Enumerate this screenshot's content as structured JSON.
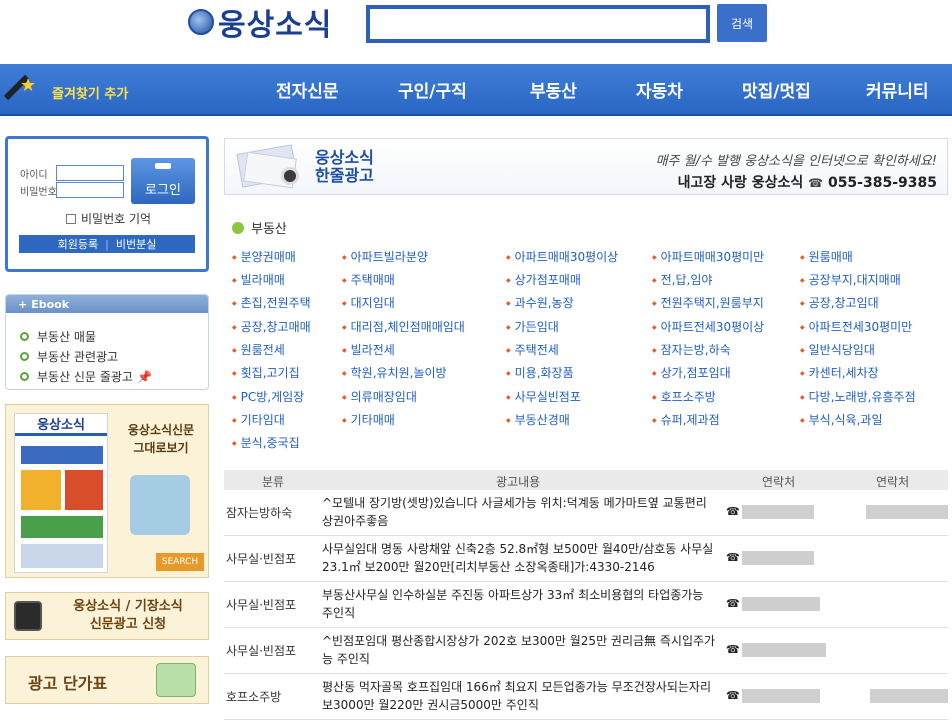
{
  "header": {
    "logo_text": "웅상소식",
    "search_value": "",
    "search_button": "검색"
  },
  "nav": {
    "favorite": "즐겨찾기 추가",
    "items": [
      "전자신문",
      "구인/구직",
      "부동산",
      "자동차",
      "맛집/멋집",
      "커뮤니티"
    ]
  },
  "login": {
    "id_label": "아이디",
    "pw_label": "비밀번호",
    "button": "로그인",
    "remember": "비밀번호 기억",
    "register": "회원등록",
    "find_pw": "비번분실"
  },
  "ebook": {
    "title": "Ebook",
    "items": [
      "부동산 매물",
      "부동산 관련광고",
      "부동산 신문 줄광고"
    ]
  },
  "banners": {
    "paper_title": "웅상소식",
    "paper_side": "웅상소식신문\n그대로보기",
    "search_tag": "SEARCH",
    "apply": "웅상소식 / 기장소식\n신문광고 신청",
    "price": "광고 단가표"
  },
  "hanjul": {
    "title": "웅상소식\n한줄광고",
    "notice": "매주 월/수 발행 웅상소식을 인터넷으로 확인하세요!",
    "contact_prefix": "내고장 사랑 웅상소식",
    "phone": "055-385-9385"
  },
  "section_title": "부동산",
  "categories": [
    [
      "분양권매매",
      "아파트빌라분양",
      "아파트매매30평이상",
      "아파트매매30평미만",
      "원룸매매"
    ],
    [
      "빌라매매",
      "주택매매",
      "상가점포매매",
      "전,답,임야",
      "공장부지,대지매매"
    ],
    [
      "촌집,전원주택",
      "대지임대",
      "과수원,농장",
      "전원주택지,원룸부지",
      "공장,창고임대"
    ],
    [
      "공장,창고매매",
      "대리점,체인점매매임대",
      "가든임대",
      "아파트전세30평이상",
      "아파트전세30평미만"
    ],
    [
      "원룸전세",
      "빌라전세",
      "주택전세",
      "잠자는방,하숙",
      "일반식당임대"
    ],
    [
      "횟집,고기집",
      "학원,유치원,놀이방",
      "미용,화장품",
      "상가,점포임대",
      "카센터,세차장"
    ],
    [
      "PC방,게임장",
      "의류매장임대",
      "사무실빈점포",
      "호프소주방",
      "다방,노래방,유흥주점"
    ],
    [
      "기타임대",
      "기타매매",
      "부동산경매",
      "슈퍼,제과점",
      "부식,식육,과일"
    ],
    [
      "분식,중국집"
    ]
  ],
  "table": {
    "headers": [
      "분류",
      "광고내용",
      "연락처",
      "연락처"
    ],
    "phone_icon": "☎",
    "rows": [
      {
        "category": "잠자는방하숙",
        "content": "^모텔내 장기방(셋방)있습니다 사글세가능 위치:덕계동 메가마트옆 교통편리 상권아주좋음"
      },
      {
        "category": "사무실·빈점포",
        "content": "사무실임대 명동 사랑채앞 신축2층 52.8㎡형 보500만 월40만/삼호동 사무실23.1㎡ 보200만 월20만[리치부동산 소장옥종태]가:4330-2146"
      },
      {
        "category": "사무실·빈점포",
        "content": "부동산사무실 인수하실분 주진동 아파트상가 33㎡ 최소비용협의 타업종가능 주인직"
      },
      {
        "category": "사무실·빈점포",
        "content": "^빈점포임대 평산종합시장상가 202호 보300만 월25만 권리금無 즉시입주가능 주인직"
      },
      {
        "category": "호프소주방",
        "content": "평산동 먹자골목 호프집임대 166㎡ 최요지 모든업종가능 무조건장사되는자리 보3000만 월220만 권시금5000만 주인직"
      }
    ]
  }
}
